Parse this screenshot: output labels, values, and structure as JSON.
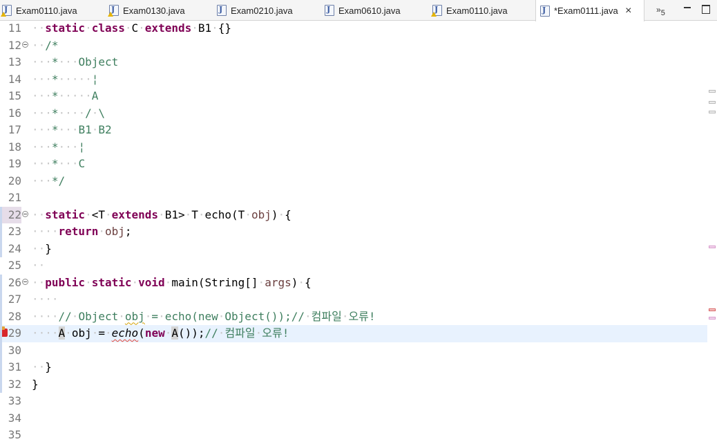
{
  "tabs": [
    {
      "label": "Exam0110.java",
      "warning": true,
      "active": false,
      "icon": "java-file-warning-icon"
    },
    {
      "label": "Exam0130.java",
      "warning": true,
      "active": false,
      "icon": "java-file-warning-icon"
    },
    {
      "label": "Exam0210.java",
      "warning": false,
      "active": false,
      "icon": "java-file-icon"
    },
    {
      "label": "Exam0610.java",
      "warning": false,
      "active": false,
      "icon": "java-file-icon"
    },
    {
      "label": "Exam0110.java",
      "warning": true,
      "active": false,
      "icon": "java-file-warning-icon"
    },
    {
      "label": "*Exam0111.java",
      "warning": false,
      "active": true,
      "icon": "java-file-icon"
    }
  ],
  "tab_close_glyph": "×",
  "overflow": {
    "chevron": "»",
    "count": "5"
  },
  "window_controls": [
    "minimize-icon",
    "maximize-icon"
  ],
  "colors": {
    "keyword": "#7f0055",
    "comment": "#3f7f5f",
    "current_line": "#e8f2fe",
    "error": "#d8262b"
  },
  "lines": [
    {
      "n": "11",
      "code": [
        [
          "ws",
          "··"
        ],
        [
          "kw",
          "static"
        ],
        [
          "ws",
          "·"
        ],
        [
          "kw",
          "class"
        ],
        [
          "ws",
          "·"
        ],
        [
          "fn",
          "C"
        ],
        [
          "ws",
          "·"
        ],
        [
          "kw",
          "extends"
        ],
        [
          "ws",
          "·"
        ],
        [
          "fn",
          "B1"
        ],
        [
          "ws",
          "·"
        ],
        [
          "fn",
          "{}"
        ]
      ]
    },
    {
      "n": "12",
      "fold": true,
      "code": [
        [
          "ws",
          "··"
        ],
        [
          "cm",
          "/*"
        ]
      ]
    },
    {
      "n": "13",
      "code": [
        [
          "ws",
          "···"
        ],
        [
          "cm",
          "*"
        ],
        [
          "ws",
          "···"
        ],
        [
          "cm",
          "Object"
        ]
      ]
    },
    {
      "n": "14",
      "code": [
        [
          "ws",
          "···"
        ],
        [
          "cm",
          "*"
        ],
        [
          "ws",
          "·····"
        ],
        [
          "cm",
          "¦"
        ]
      ]
    },
    {
      "n": "15",
      "code": [
        [
          "ws",
          "···"
        ],
        [
          "cm",
          "*"
        ],
        [
          "ws",
          "·····"
        ],
        [
          "cm",
          "A"
        ]
      ]
    },
    {
      "n": "16",
      "code": [
        [
          "ws",
          "···"
        ],
        [
          "cm",
          "*"
        ],
        [
          "ws",
          "····"
        ],
        [
          "cm",
          "/"
        ],
        [
          "ws",
          "·"
        ],
        [
          "cm",
          "\\"
        ]
      ]
    },
    {
      "n": "17",
      "code": [
        [
          "ws",
          "···"
        ],
        [
          "cm",
          "*"
        ],
        [
          "ws",
          "···"
        ],
        [
          "cm",
          "B1"
        ],
        [
          "ws",
          "·"
        ],
        [
          "cm",
          "B2"
        ]
      ]
    },
    {
      "n": "18",
      "code": [
        [
          "ws",
          "···"
        ],
        [
          "cm",
          "*"
        ],
        [
          "ws",
          "···"
        ],
        [
          "cm",
          "¦"
        ]
      ]
    },
    {
      "n": "19",
      "code": [
        [
          "ws",
          "···"
        ],
        [
          "cm",
          "*"
        ],
        [
          "ws",
          "···"
        ],
        [
          "cm",
          "C"
        ]
      ]
    },
    {
      "n": "20",
      "code": [
        [
          "ws",
          "···"
        ],
        [
          "cm",
          "*/"
        ]
      ]
    },
    {
      "n": "21",
      "code": []
    },
    {
      "n": "22",
      "fold": true,
      "hl": true,
      "code": [
        [
          "ws",
          "··"
        ],
        [
          "kw",
          "static"
        ],
        [
          "ws",
          "·"
        ],
        [
          "fn",
          "<T"
        ],
        [
          "ws",
          "·"
        ],
        [
          "kw",
          "extends"
        ],
        [
          "ws",
          "·"
        ],
        [
          "fn",
          "B1>"
        ],
        [
          "ws",
          "·"
        ],
        [
          "fn",
          "T"
        ],
        [
          "ws",
          "·"
        ],
        [
          "fn",
          "echo(T"
        ],
        [
          "ws",
          "·"
        ],
        [
          "var",
          "obj"
        ],
        [
          "fn",
          ")"
        ],
        [
          "ws",
          "·"
        ],
        [
          "fn",
          "{"
        ]
      ]
    },
    {
      "n": "23",
      "code": [
        [
          "ws",
          "····"
        ],
        [
          "kw",
          "return"
        ],
        [
          "ws",
          "·"
        ],
        [
          "var",
          "obj"
        ],
        [
          "fn",
          ";"
        ]
      ]
    },
    {
      "n": "24",
      "code": [
        [
          "ws",
          "··"
        ],
        [
          "fn",
          "}"
        ]
      ]
    },
    {
      "n": "25",
      "code": [
        [
          "ws",
          "··"
        ]
      ]
    },
    {
      "n": "26",
      "fold": true,
      "code": [
        [
          "ws",
          "··"
        ],
        [
          "kw",
          "public"
        ],
        [
          "ws",
          "·"
        ],
        [
          "kw",
          "static"
        ],
        [
          "ws",
          "·"
        ],
        [
          "kw",
          "void"
        ],
        [
          "ws",
          "·"
        ],
        [
          "fn",
          "main(String[]"
        ],
        [
          "ws",
          "·"
        ],
        [
          "var",
          "args"
        ],
        [
          "fn",
          ")"
        ],
        [
          "ws",
          "·"
        ],
        [
          "fn",
          "{"
        ]
      ]
    },
    {
      "n": "27",
      "code": [
        [
          "ws",
          "····"
        ]
      ]
    },
    {
      "n": "28",
      "code": [
        [
          "ws",
          "····"
        ],
        [
          "cm",
          "//"
        ],
        [
          "ws",
          "·"
        ],
        [
          "cm",
          "Object"
        ],
        [
          "ws",
          "·"
        ],
        [
          "cmy",
          "obj"
        ],
        [
          "ws",
          "·"
        ],
        [
          "cm",
          "="
        ],
        [
          "ws",
          "·"
        ],
        [
          "cm",
          "echo(new"
        ],
        [
          "ws",
          "·"
        ],
        [
          "cm",
          "Object());//"
        ],
        [
          "ws",
          "·"
        ],
        [
          "cm",
          "컴파일"
        ],
        [
          "ws",
          "·"
        ],
        [
          "cm",
          "오류!"
        ]
      ]
    },
    {
      "n": "29",
      "current": true,
      "error": true,
      "code": [
        [
          "ws",
          "····"
        ],
        [
          "ty",
          "A"
        ],
        [
          "ws",
          "·"
        ],
        [
          "var2",
          "obj"
        ],
        [
          "ws",
          "·"
        ],
        [
          "fn",
          "="
        ],
        [
          "ws",
          "·"
        ],
        [
          "sq",
          "echo"
        ],
        [
          "fn",
          "("
        ],
        [
          "kw",
          "new"
        ],
        [
          "ws",
          "·"
        ],
        [
          "ty",
          "A"
        ],
        [
          "fn",
          "());"
        ],
        [
          "cm",
          "//"
        ],
        [
          "ws",
          "·"
        ],
        [
          "cm",
          "컴파일"
        ],
        [
          "ws",
          "·"
        ],
        [
          "cm",
          "오류!"
        ]
      ]
    },
    {
      "n": "30",
      "code": []
    },
    {
      "n": "31",
      "code": [
        [
          "ws",
          "··"
        ],
        [
          "fn",
          "}"
        ]
      ]
    },
    {
      "n": "32",
      "code": [
        [
          "fn",
          "}"
        ]
      ]
    },
    {
      "n": "33",
      "code": []
    },
    {
      "n": "34",
      "code": []
    },
    {
      "n": "35",
      "code": []
    }
  ]
}
